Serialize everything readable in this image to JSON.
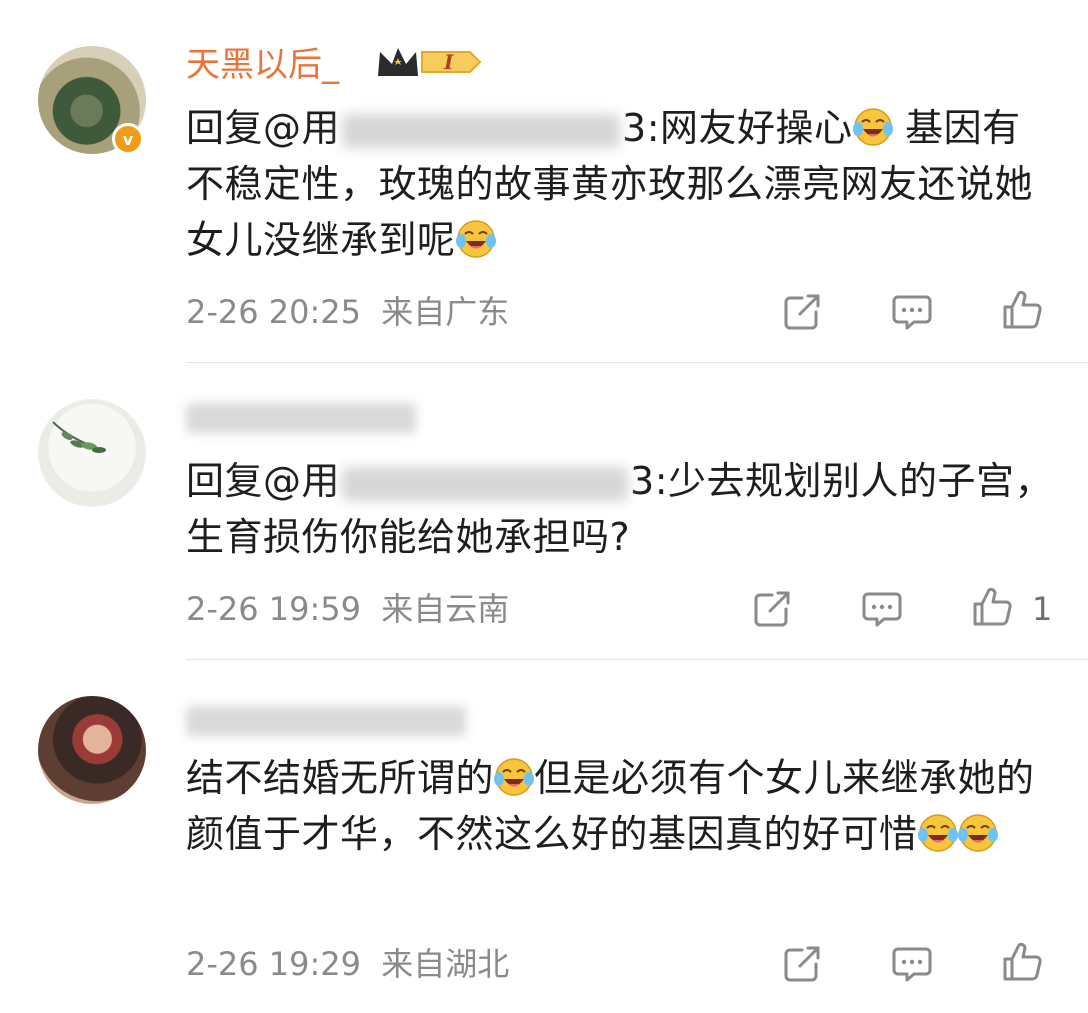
{
  "comments": [
    {
      "username": "天黑以后_",
      "level_badge": "I",
      "reply_prefix": "回复@",
      "mention_visible": "用",
      "mention_tail": "3",
      "text": ":网友好操心",
      "text2": " 基因有不稳定性，玫瑰的故事黄亦玫那么漂亮网友还说她女儿没继承到呢",
      "timestamp": "2-26 20:25",
      "location": "来自广东",
      "like_count": ""
    },
    {
      "username": "",
      "reply_prefix": "回复@",
      "mention_visible": "用",
      "mention_tail": "3",
      "text": ":少去规划别人的子宫，生育损伤你能给她承担吗?",
      "timestamp": "2-26 19:59",
      "location": "来自云南",
      "like_count": "1"
    },
    {
      "username": "",
      "text1": "结不结婚无所谓的",
      "text2": "但是必须有个女儿来继承她的颜值于才华，不然这么好的基因真的好可惜",
      "timestamp": "2-26 19:29",
      "location": "来自湖北",
      "like_count": ""
    }
  ],
  "icons": {
    "share": "share-icon",
    "comment": "comment-icon",
    "like": "thumbs-up-icon",
    "emoji": "laugh-cry-emoji-icon",
    "verified": "verified-v-icon",
    "crown": "crown-badge-icon"
  },
  "colors": {
    "username": "#e8763b",
    "text": "#1e1e1e",
    "meta": "#8a8a8a",
    "icon": "#8a8a8a",
    "badge_orange": "#f39a16"
  }
}
